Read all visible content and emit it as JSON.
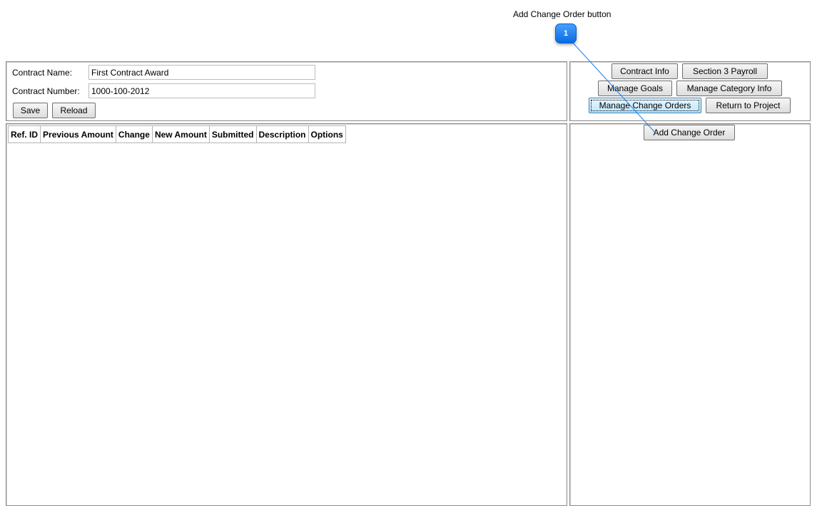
{
  "callout": {
    "label": "Add Change Order button",
    "number": "1"
  },
  "contract": {
    "name_label": "Contract Name:",
    "name_value": "First Contract Award",
    "number_label": "Contract Number:",
    "number_value": "1000-100-2012",
    "save_label": "Save",
    "reload_label": "Reload"
  },
  "nav": {
    "contract_info": "Contract Info",
    "section3_payroll": "Section 3 Payroll",
    "manage_goals": "Manage Goals",
    "manage_category_info": "Manage Category Info",
    "manage_change_orders": "Manage Change Orders",
    "return_to_project": "Return to Project",
    "active_item": "Manage Change Orders"
  },
  "change_orders": {
    "columns": [
      "Ref. ID",
      "Previous Amount",
      "Change",
      "New Amount",
      "Submitted",
      "Description",
      "Options"
    ],
    "rows": []
  },
  "actions": {
    "add_change_order": "Add Change Order"
  },
  "colors": {
    "callout_blue": "#1a7ef0",
    "panel_border": "#8a8a8a",
    "active_button": "#bee6fd"
  }
}
